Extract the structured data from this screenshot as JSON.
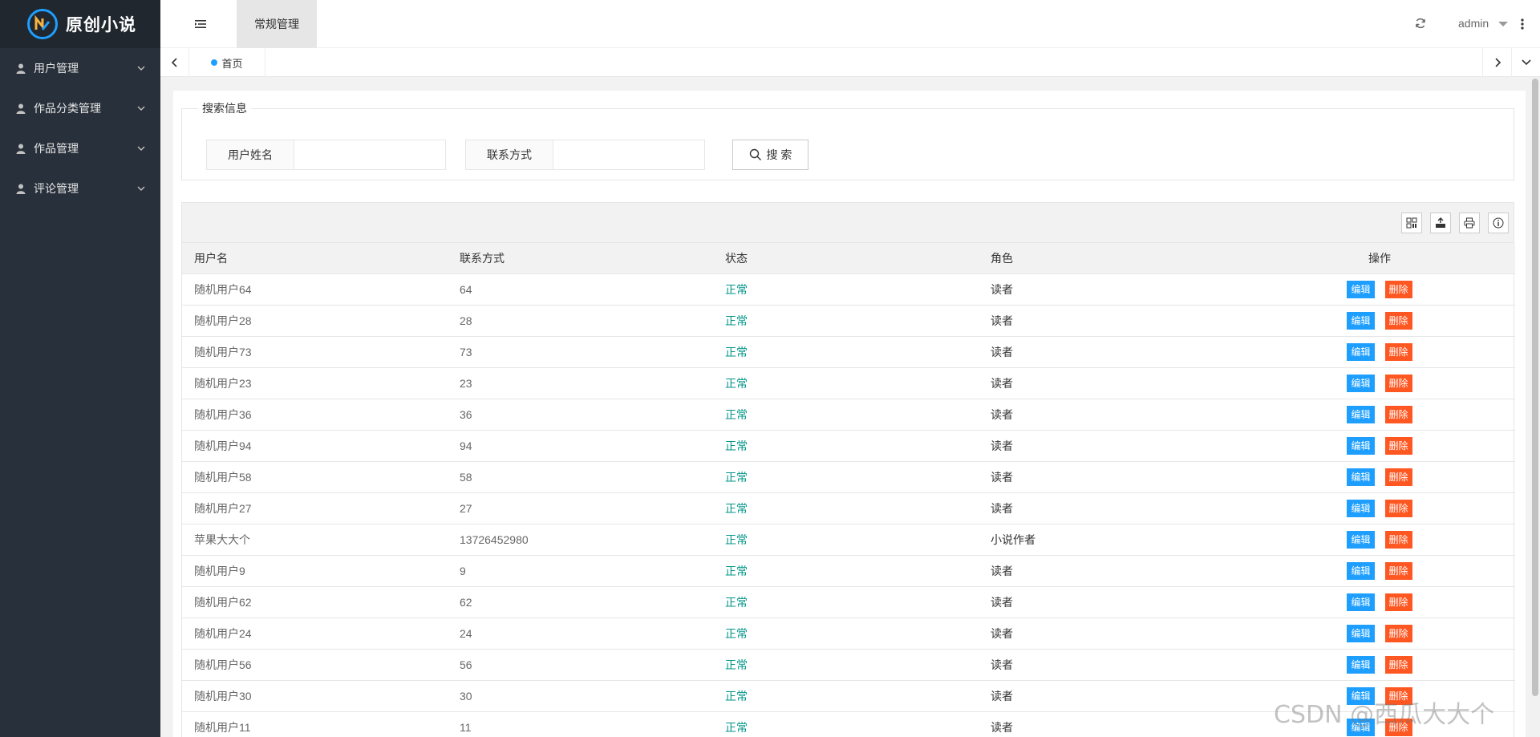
{
  "app": {
    "title": "原创小说"
  },
  "sidebar": {
    "items": [
      {
        "label": "用户管理"
      },
      {
        "label": "作品分类管理"
      },
      {
        "label": "作品管理"
      },
      {
        "label": "评论管理"
      }
    ]
  },
  "topbar": {
    "tab": "常规管理",
    "user": "admin",
    "icons": [
      "menu-toggle-icon",
      "refresh-icon",
      "caret-down-icon",
      "more-vertical-icon"
    ]
  },
  "tabstrip": {
    "home": "首页"
  },
  "search": {
    "legend": "搜索信息",
    "username_label": "用户姓名",
    "username_value": "",
    "contact_label": "联系方式",
    "contact_value": "",
    "button_label": "搜 索"
  },
  "table": {
    "columns": [
      "用户名",
      "联系方式",
      "状态",
      "角色",
      "操作"
    ],
    "edit_label": "编辑",
    "delete_label": "删除",
    "rows": [
      {
        "name": "随机用户64",
        "contact": "64",
        "status": "正常",
        "role": "读者"
      },
      {
        "name": "随机用户28",
        "contact": "28",
        "status": "正常",
        "role": "读者"
      },
      {
        "name": "随机用户73",
        "contact": "73",
        "status": "正常",
        "role": "读者"
      },
      {
        "name": "随机用户23",
        "contact": "23",
        "status": "正常",
        "role": "读者"
      },
      {
        "name": "随机用户36",
        "contact": "36",
        "status": "正常",
        "role": "读者"
      },
      {
        "name": "随机用户94",
        "contact": "94",
        "status": "正常",
        "role": "读者"
      },
      {
        "name": "随机用户58",
        "contact": "58",
        "status": "正常",
        "role": "读者"
      },
      {
        "name": "随机用户27",
        "contact": "27",
        "status": "正常",
        "role": "读者"
      },
      {
        "name": "苹果大大个",
        "contact": "13726452980",
        "status": "正常",
        "role": "小说作者"
      },
      {
        "name": "随机用户9",
        "contact": "9",
        "status": "正常",
        "role": "读者"
      },
      {
        "name": "随机用户62",
        "contact": "62",
        "status": "正常",
        "role": "读者"
      },
      {
        "name": "随机用户24",
        "contact": "24",
        "status": "正常",
        "role": "读者"
      },
      {
        "name": "随机用户56",
        "contact": "56",
        "status": "正常",
        "role": "读者"
      },
      {
        "name": "随机用户30",
        "contact": "30",
        "status": "正常",
        "role": "读者"
      },
      {
        "name": "随机用户11",
        "contact": "11",
        "status": "正常",
        "role": "读者"
      }
    ]
  },
  "watermark": "CSDN @西瓜大大个",
  "colors": {
    "sidebar_bg": "#28303b",
    "accent": "#1e9fff",
    "danger": "#ff5722",
    "status_ok": "#009688"
  }
}
